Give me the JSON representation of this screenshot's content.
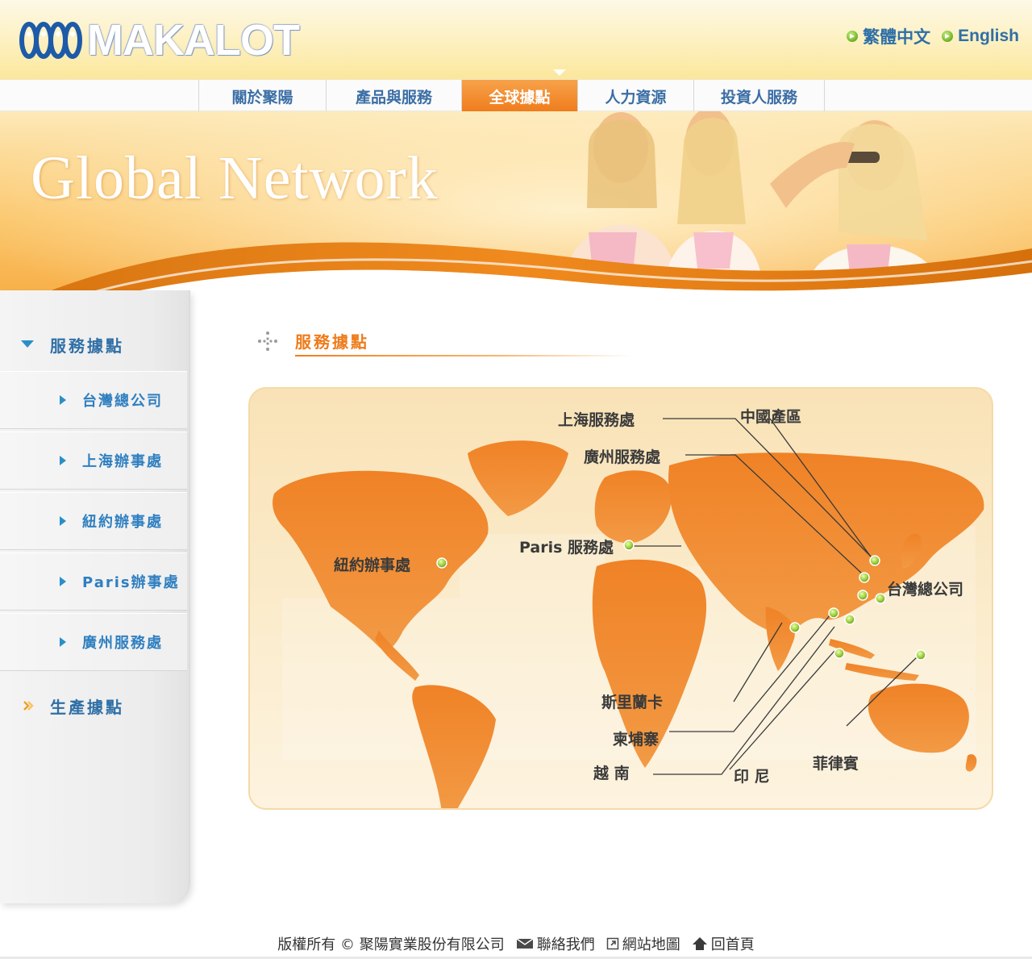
{
  "header": {
    "logo_text": "MAKALOT",
    "languages": [
      {
        "label": "繁體中文",
        "icon": "arrow-bullet-icon"
      },
      {
        "label": "English",
        "icon": "arrow-bullet-icon"
      }
    ]
  },
  "nav": {
    "items": [
      {
        "label": "關於聚陽",
        "active": false
      },
      {
        "label": "產品與服務",
        "active": false
      },
      {
        "label": "全球據點",
        "active": true
      },
      {
        "label": "人力資源",
        "active": false
      },
      {
        "label": "投資人服務",
        "active": false
      }
    ]
  },
  "banner": {
    "title": "Global Network"
  },
  "sidebar": {
    "service_heading": "服務據點",
    "service_items": [
      {
        "label": "台灣總公司"
      },
      {
        "label": "上海辦事處"
      },
      {
        "label": "紐約辦事處"
      },
      {
        "label": "Paris辦事處"
      },
      {
        "label": "廣州服務處"
      }
    ],
    "production_heading": "生產據點"
  },
  "main": {
    "section_title": "服務據點",
    "map_labels": {
      "shanghai": "上海服務處",
      "china_factory": "中國產區",
      "guangzhou": "廣州服務處",
      "paris": "Paris 服務處",
      "newyork": "紐約辦事處",
      "taiwan_hq": "台灣總公司",
      "sri_lanka": "斯里蘭卡",
      "cambodia": "柬埔寨",
      "vietnam": "越 南",
      "indonesia": "印 尼",
      "philippines": "菲律賓"
    }
  },
  "footer": {
    "copyright": "版權所有 © 聚陽實業股份有限公司",
    "contact": "聯絡我們",
    "sitemap": "網站地圖",
    "home": "回首頁"
  },
  "colors": {
    "brand_orange": "#ef7c1c",
    "brand_blue": "#2f6fa6",
    "marker_green": "#9ccc3a"
  }
}
